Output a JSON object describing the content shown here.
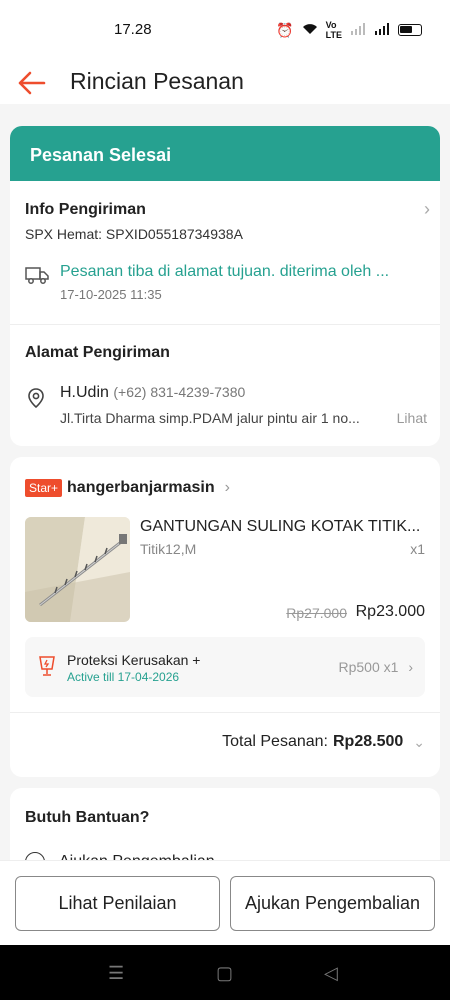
{
  "status_bar": {
    "time": "17.28"
  },
  "header": {
    "title": "Rincian Pesanan"
  },
  "order_status": "Pesanan Selesai",
  "shipping_info": {
    "title": "Info Pengiriman",
    "courier": "SPX Hemat: SPXID05518734938A",
    "tracking_message": "Pesanan tiba di alamat tujuan. diterima oleh ...",
    "tracking_time": "17-10-2025 11:35"
  },
  "address": {
    "title": "Alamat Pengiriman",
    "name": "H.Udin",
    "phone": "(+62) 831-4239-7380",
    "line": "Jl.Tirta Dharma simp.PDAM jalur pintu air 1 no...",
    "link": "Lihat"
  },
  "shop": {
    "badge": "Star+",
    "name": "hangerbanjarmasin"
  },
  "product": {
    "name": "GANTUNGAN SULING KOTAK TITIK...",
    "variant": "Titik12,M",
    "qty": "x1",
    "price_old": "Rp27.000",
    "price_new": "Rp23.000"
  },
  "protection": {
    "title": "Proteksi Kerusakan +",
    "active": "Active till 17-04-2026",
    "price": "Rp500 x1"
  },
  "total": {
    "label": "Total Pesanan:",
    "value": "Rp28.500"
  },
  "help": {
    "title": "Butuh Bantuan?",
    "item": "Ajukan Pengembalian"
  },
  "buttons": {
    "review": "Lihat Penilaian",
    "return": "Ajukan Pengembalian"
  },
  "colors": {
    "accent": "#26a190",
    "brand": "#ee4d2d"
  }
}
